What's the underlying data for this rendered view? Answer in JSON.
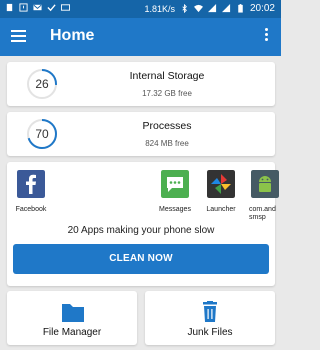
{
  "status_bar": {
    "speed": "1.81K/s",
    "time": "20:02"
  },
  "app_bar": {
    "title": "Home"
  },
  "storage": {
    "percent": 26,
    "title": "Internal Storage",
    "free": "17.32 GB free"
  },
  "processes": {
    "percent": 70,
    "title": "Processes",
    "free": "824 MB free"
  },
  "apps": {
    "items": [
      {
        "name": "Facebook",
        "icon": "facebook-icon",
        "color": "#3b5998"
      },
      {
        "name": "Messages",
        "icon": "messages-icon",
        "color": "#4caf50"
      },
      {
        "name": "Launcher",
        "icon": "launcher-icon",
        "color": "#333333"
      },
      {
        "name": "com.and smsp",
        "icon": "android-icon",
        "color": "#8bc34a"
      }
    ],
    "summary": "20 Apps making your phone slow",
    "button": "CLEAN NOW"
  },
  "tools": {
    "file_manager": {
      "label": "File Manager",
      "icon": "folder-icon"
    },
    "junk_files": {
      "label": "Junk Files",
      "icon": "trash-icon"
    }
  },
  "colors": {
    "primary": "#1f78c8",
    "status_bar": "#1565a8",
    "gauge": "#1f78c8"
  }
}
